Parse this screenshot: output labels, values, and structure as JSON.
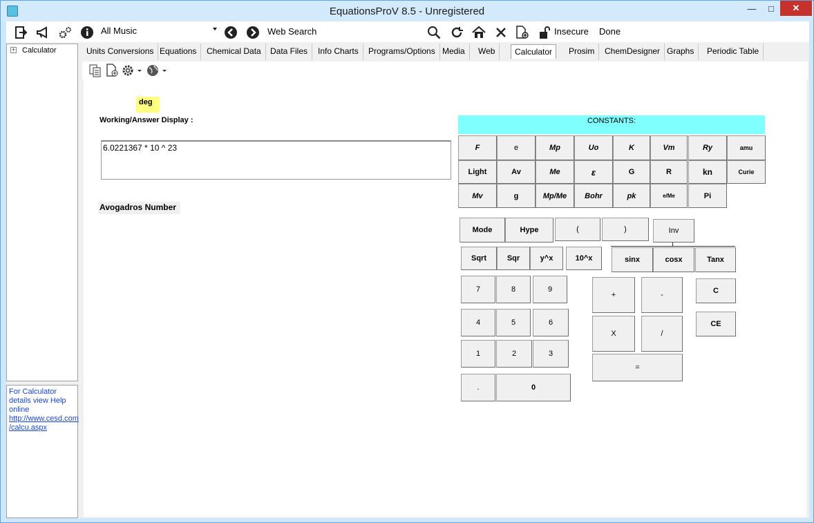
{
  "window": {
    "title": "EquationsProV 8.5 - Unregistered",
    "min": "—",
    "max": "□",
    "close": "✕"
  },
  "toolbar": {
    "music": "All Music",
    "web_search": "Web Search",
    "insecure": "Insecure",
    "done": "Done"
  },
  "tree": {
    "expander": "+",
    "root": "Calculator"
  },
  "help": {
    "line1": "For Calculator details view Help online",
    "link1": "http://www.cesd.com",
    "link2": "/calcu.aspx"
  },
  "tabs": [
    "Units Conversions",
    "Equations",
    "Chemical Data",
    "Data Files",
    "Info Charts",
    "Programs/Options",
    "Media",
    "Web",
    "Calculator",
    "Prosim",
    "ChemDesigner",
    "Graphs",
    "Periodic Table"
  ],
  "calc": {
    "deg": "deg",
    "working_label": "Working/Answer Display :",
    "display": "6.0221367 * 10 ^ 23",
    "result_label": "Avogadros Number",
    "constants_header": "CONSTANTS:",
    "constants": [
      [
        "F",
        "e",
        "Mp",
        "Uo",
        "K",
        "Vm",
        "Ry",
        "amu"
      ],
      [
        "Light",
        "Av",
        "Me",
        "ε",
        "G",
        "R",
        "kn",
        "Curie"
      ],
      [
        "Mv",
        "g",
        "Mp/Me",
        "Bohr",
        "pk",
        "e/Me",
        "Pi"
      ]
    ],
    "mode": "Mode",
    "hype": "Hype",
    "lparen": "(",
    "rparen": ")",
    "inv": "Inv",
    "sqrt": "Sqrt",
    "sqr": "Sqr",
    "yx": "y^x",
    "tenx": "10^x",
    "sinx": "sinx",
    "cosx": "cosx",
    "tanx": "Tanx",
    "digits": [
      "7",
      "8",
      "9",
      "4",
      "5",
      "6",
      "1",
      "2",
      "3"
    ],
    "dot": ".",
    "zero": "0",
    "plus": "+",
    "minus": "-",
    "times": "X",
    "divide": "/",
    "equals": "=",
    "clear": "C",
    "clear_entry": "CE"
  }
}
